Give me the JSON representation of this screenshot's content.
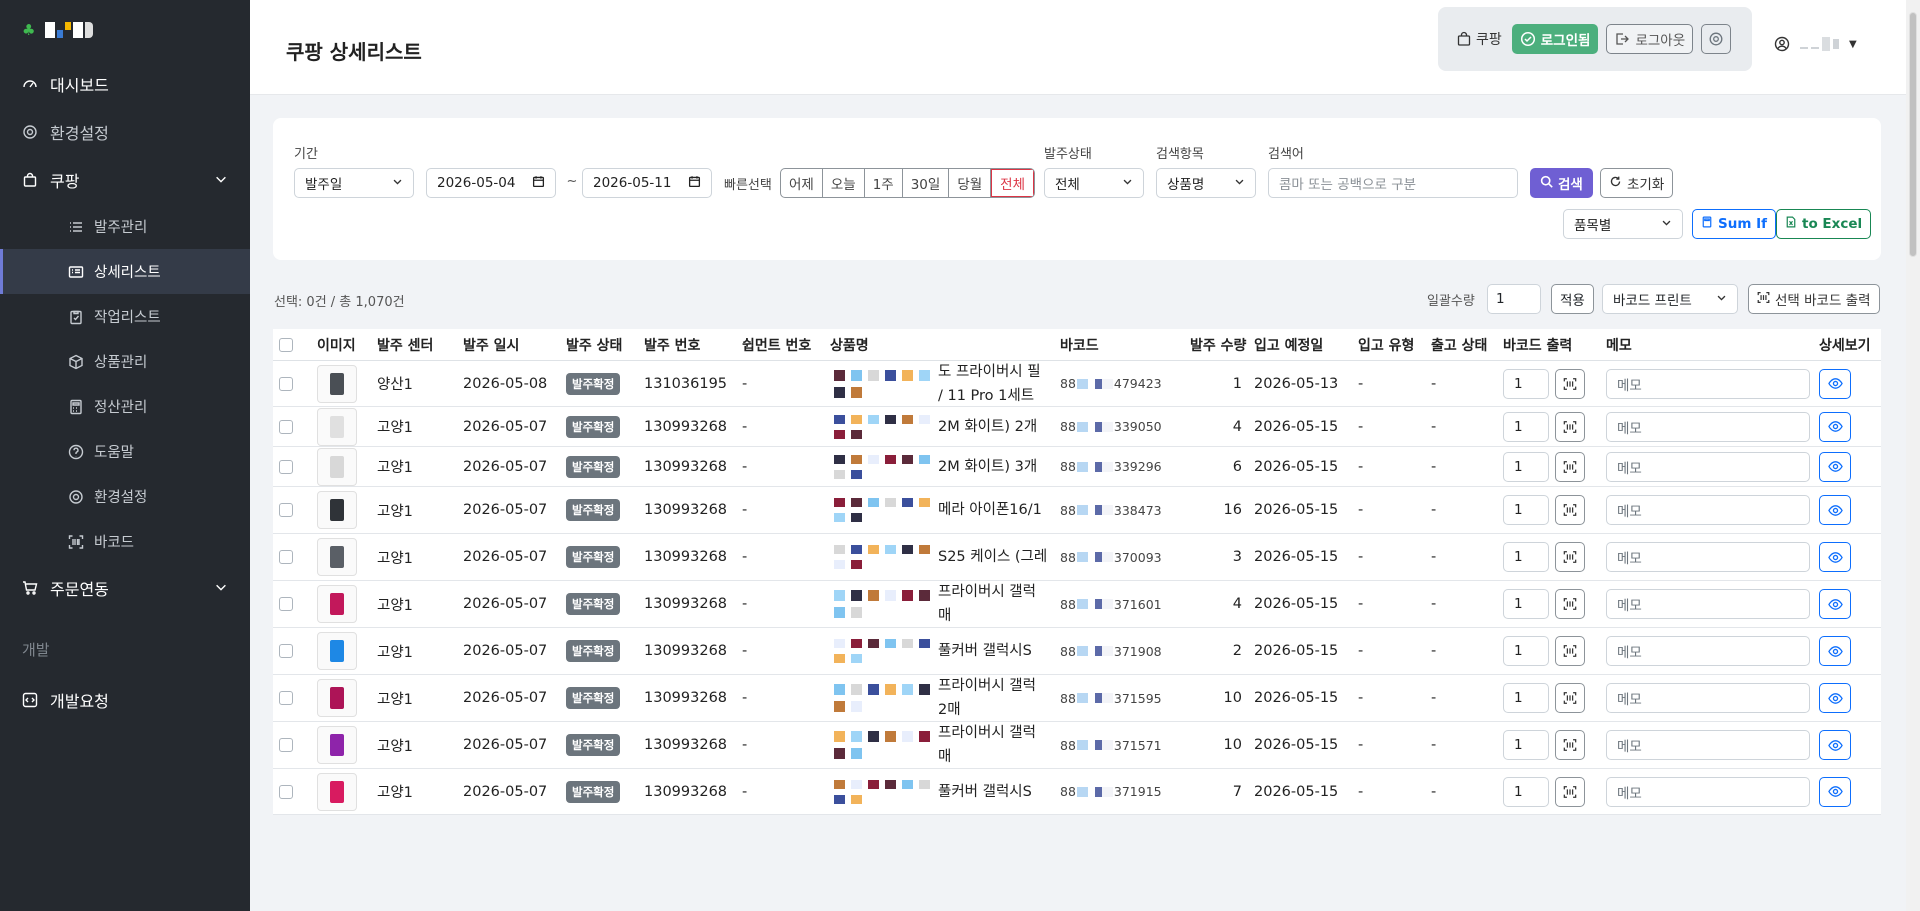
{
  "sidebar": {
    "logo_colors": [
      "#ffffff",
      "#3a7bd5",
      "#f5b700",
      "#ffffff",
      "#dddddd"
    ],
    "items": [
      {
        "label": "대시보드",
        "icon": "speedometer-icon"
      },
      {
        "label": "환경설정",
        "icon": "gear-icon"
      },
      {
        "label": "쿠팡",
        "icon": "shopping-bag-icon"
      }
    ],
    "sub_items": [
      {
        "label": "발주관리",
        "icon": "list-icon"
      },
      {
        "label": "상세리스트",
        "icon": "card-list-icon"
      },
      {
        "label": "작업리스트",
        "icon": "clipboard-icon"
      },
      {
        "label": "상품관리",
        "icon": "box-icon"
      },
      {
        "label": "정산관리",
        "icon": "calculator-icon"
      },
      {
        "label": "도움말",
        "icon": "question-icon"
      },
      {
        "label": "환경설정",
        "icon": "gear-icon"
      },
      {
        "label": "바코드",
        "icon": "barcode-scan-icon"
      }
    ],
    "order_link": {
      "label": "주문연동",
      "icon": "cart-icon"
    },
    "section_dev": "개발",
    "dev_request": {
      "label": "개발요청",
      "icon": "code-icon"
    }
  },
  "header": {
    "title": "쿠팡 상세리스트",
    "coupang_label": "쿠팡",
    "login_label": "로그인됨",
    "logout_label": "로그아웃"
  },
  "filters": {
    "period_label": "기간",
    "period_type": "발주일",
    "date_from": "2026-05-04",
    "date_sep": "~",
    "date_to": "2026-05-11",
    "quick_label": "빠른선택",
    "quick_options": [
      "어제",
      "오늘",
      "1주",
      "30일",
      "당월",
      "전체"
    ],
    "status_label": "발주상태",
    "status_value": "전체",
    "field_label": "검색항목",
    "field_value": "상품명",
    "keyword_label": "검색어",
    "keyword_placeholder": "콤마 또는 공백으로 구분",
    "search_btn": "검색",
    "reset_btn": "초기화",
    "group_value": "품목별",
    "sumif_btn": "Sum If",
    "excel_btn": "to Excel"
  },
  "summary": {
    "selection_text": "선택: 0건 / 총 1,070건",
    "bulk_label": "일괄수량",
    "bulk_qty": "1",
    "apply_btn": "적용",
    "print_type": "바코드 프린트",
    "print_btn": "선택 바코드 출력"
  },
  "table": {
    "headers": [
      "이미지",
      "발주 센터",
      "발주 일시",
      "발주 상태",
      "발주 번호",
      "쉽먼트 번호",
      "상품명",
      "바코드",
      "발주 수량",
      "입고 예정일",
      "입고 유형",
      "출고 상태",
      "바코드 출력",
      "메모",
      "상세보기"
    ],
    "memo_placeholder": "메모",
    "rows": [
      {
        "center": "양산1",
        "date": "2026-05-08",
        "status": "발주확정",
        "order_no": "131036195",
        "shipment": "-",
        "name_lines": [
          "도 프라이버시 필",
          "/ 11 Pro 1세트"
        ],
        "barcode_prefix": "88",
        "barcode_suffix": "479423",
        "qty": "1",
        "inbound": "2026-05-13",
        "type": "-",
        "out": "-",
        "print_qty": "1",
        "thumb": "#4a4f55"
      },
      {
        "center": "고양1",
        "date": "2026-05-07",
        "status": "발주확정",
        "order_no": "130993268",
        "shipment": "-",
        "name_lines": [
          "2M 화이트) 2개"
        ],
        "barcode_prefix": "88",
        "barcode_suffix": "339050",
        "qty": "4",
        "inbound": "2026-05-15",
        "type": "-",
        "out": "-",
        "print_qty": "1",
        "thumb": "#e0e0e0"
      },
      {
        "center": "고양1",
        "date": "2026-05-07",
        "status": "발주확정",
        "order_no": "130993268",
        "shipment": "-",
        "name_lines": [
          "2M 화이트) 3개"
        ],
        "barcode_prefix": "88",
        "barcode_suffix": "339296",
        "qty": "6",
        "inbound": "2026-05-15",
        "type": "-",
        "out": "-",
        "print_qty": "1",
        "thumb": "#d8d8d8"
      },
      {
        "center": "고양1",
        "date": "2026-05-07",
        "status": "발주확정",
        "order_no": "130993268",
        "shipment": "-",
        "name_lines": [
          "메라 아이폰16/1"
        ],
        "barcode_prefix": "88",
        "barcode_suffix": "338473",
        "qty": "16",
        "inbound": "2026-05-15",
        "type": "-",
        "out": "-",
        "print_qty": "1",
        "thumb": "#2f3338"
      },
      {
        "center": "고양1",
        "date": "2026-05-07",
        "status": "발주확정",
        "order_no": "130993268",
        "shipment": "-",
        "name_lines": [
          "S25 케이스 (그레"
        ],
        "barcode_prefix": "88",
        "barcode_suffix": "370093",
        "qty": "3",
        "inbound": "2026-05-15",
        "type": "-",
        "out": "-",
        "print_qty": "1",
        "thumb": "#5a5f66"
      },
      {
        "center": "고양1",
        "date": "2026-05-07",
        "status": "발주확정",
        "order_no": "130993268",
        "shipment": "-",
        "name_lines": [
          "프라이버시 갤럭",
          "매"
        ],
        "barcode_prefix": "88",
        "barcode_suffix": "371601",
        "qty": "4",
        "inbound": "2026-05-15",
        "type": "-",
        "out": "-",
        "print_qty": "1",
        "thumb": "#c2185b"
      },
      {
        "center": "고양1",
        "date": "2026-05-07",
        "status": "발주확정",
        "order_no": "130993268",
        "shipment": "-",
        "name_lines": [
          "풀커버 갤럭시S"
        ],
        "barcode_prefix": "88",
        "barcode_suffix": "371908",
        "qty": "2",
        "inbound": "2026-05-15",
        "type": "-",
        "out": "-",
        "print_qty": "1",
        "thumb": "#1e88e5"
      },
      {
        "center": "고양1",
        "date": "2026-05-07",
        "status": "발주확정",
        "order_no": "130993268",
        "shipment": "-",
        "name_lines": [
          "프라이버시 갤럭",
          "2매"
        ],
        "barcode_prefix": "88",
        "barcode_suffix": "371595",
        "qty": "10",
        "inbound": "2026-05-15",
        "type": "-",
        "out": "-",
        "print_qty": "1",
        "thumb": "#ad1457"
      },
      {
        "center": "고양1",
        "date": "2026-05-07",
        "status": "발주확정",
        "order_no": "130993268",
        "shipment": "-",
        "name_lines": [
          "프라이버시 갤럭",
          "매"
        ],
        "barcode_prefix": "88",
        "barcode_suffix": "371571",
        "qty": "10",
        "inbound": "2026-05-15",
        "type": "-",
        "out": "-",
        "print_qty": "1",
        "thumb": "#8e24aa"
      },
      {
        "center": "고양1",
        "date": "2026-05-07",
        "status": "발주확정",
        "order_no": "130993268",
        "shipment": "-",
        "name_lines": [
          "풀커버 갤럭시S"
        ],
        "barcode_prefix": "88",
        "barcode_suffix": "371915",
        "qty": "7",
        "inbound": "2026-05-15",
        "type": "-",
        "out": "-",
        "print_qty": "1",
        "thumb": "#d81b60"
      }
    ]
  },
  "colors": {
    "sidebar_bg": "#25292f",
    "accent": "#6f5fd3",
    "login_green": "#4caf7d",
    "badge_gray": "#6c757d",
    "quick_selected": "#dc3545"
  }
}
